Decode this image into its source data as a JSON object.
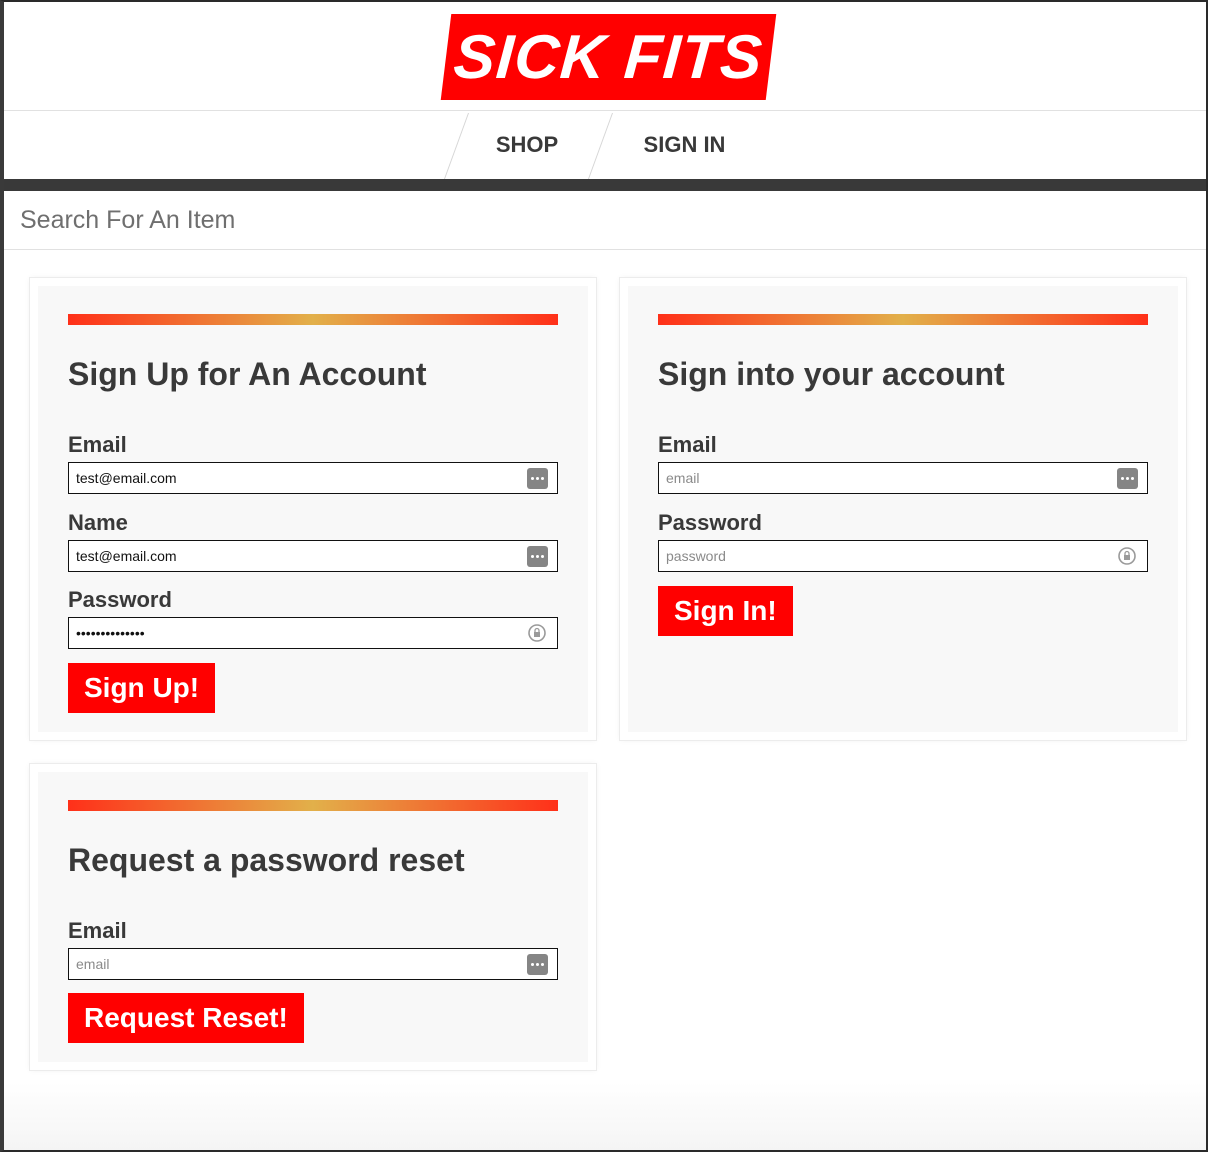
{
  "brand": {
    "logo_text": "SICK FITS",
    "accent": "#ff0000",
    "dark": "#393939"
  },
  "nav": {
    "items": [
      {
        "label": "SHOP"
      },
      {
        "label": "SIGN IN"
      }
    ]
  },
  "search": {
    "placeholder": "Search For An Item"
  },
  "signup": {
    "title": "Sign Up for An Account",
    "email_label": "Email",
    "email_value": "test@email.com",
    "name_label": "Name",
    "name_value": "test@email.com",
    "password_label": "Password",
    "password_value": "••••••••••••••",
    "button": "Sign Up!"
  },
  "signin": {
    "title": "Sign into your account",
    "email_label": "Email",
    "email_placeholder": "email",
    "password_label": "Password",
    "password_placeholder": "password",
    "button": "Sign In!"
  },
  "reset": {
    "title": "Request a password reset",
    "email_label": "Email",
    "email_placeholder": "email",
    "button": "Request Reset!"
  },
  "icons": {
    "keychain": "autofill-keychain-icon",
    "password_lock": "password-lock-icon"
  }
}
